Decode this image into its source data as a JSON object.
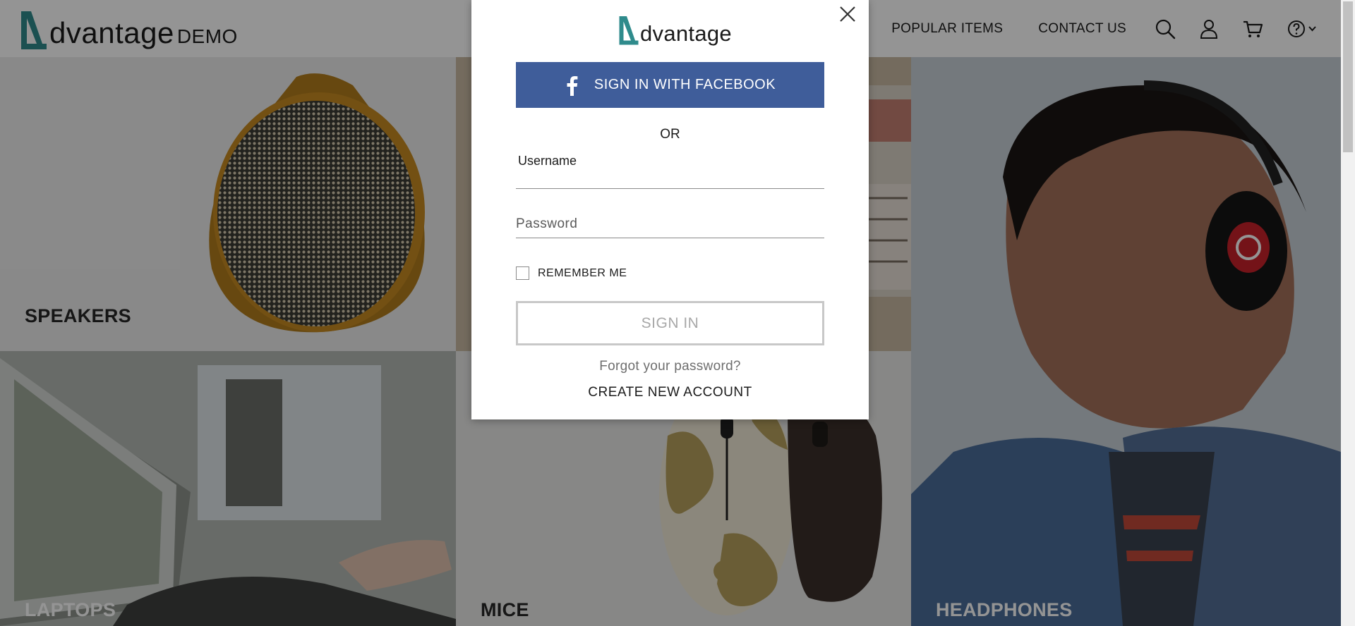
{
  "header": {
    "logo_word": "dvantage",
    "logo_demo": "DEMO",
    "nav": [
      {
        "label": "POPULAR ITEMS"
      },
      {
        "label": "CONTACT US"
      }
    ],
    "icons": [
      "search-icon",
      "user-icon",
      "cart-icon",
      "help-icon",
      "chevron-down-icon"
    ]
  },
  "categories": [
    {
      "label": "SPEAKERS"
    },
    {
      "label": "LAPTOPS"
    },
    {
      "label": "MICE"
    },
    {
      "label": "HEADPHONES"
    }
  ],
  "login": {
    "logo_word": "dvantage",
    "facebook_label": "SIGN IN WITH FACEBOOK",
    "or_label": "OR",
    "username_label": "Username",
    "password_label": "Password",
    "remember_label": "REMEMBER ME",
    "signin_label": "SIGN IN",
    "forgot_label": "Forgot your password?",
    "create_label": "CREATE NEW ACCOUNT"
  },
  "colors": {
    "brand_teal": "#2f8b8c",
    "facebook_blue": "#3f5d9a",
    "overlay": "rgba(0,0,0,0.42)"
  }
}
